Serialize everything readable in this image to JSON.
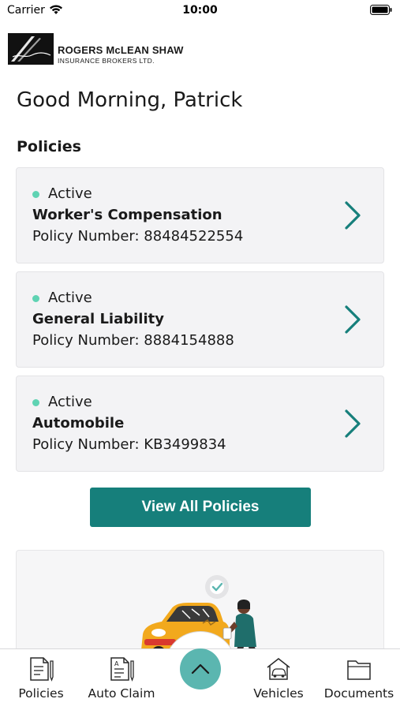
{
  "status_bar": {
    "carrier": "Carrier",
    "time": "10:00",
    "icons": [
      "wifi-icon",
      "battery-icon"
    ]
  },
  "brand": {
    "name": "ROGERS McLEAN SHAW",
    "subtitle": "INSURANCE BROKERS LTD."
  },
  "greeting": "Good Morning, Patrick",
  "policies_section": {
    "title": "Policies",
    "status_color": "#5fd3b3",
    "items": [
      {
        "status": "Active",
        "name": "Worker's Compensation",
        "number_label": "Policy Number:",
        "number": "88484522554"
      },
      {
        "status": "Active",
        "name": "General Liability",
        "number_label": "Policy Number:",
        "number": "8884154888"
      },
      {
        "status": "Active",
        "name": "Automobile",
        "number_label": "Policy Number:",
        "number": "KB3499834"
      }
    ],
    "view_all_label": "View All Policies"
  },
  "colors": {
    "accent": "#167f7b",
    "accent_light": "#5bb6b0",
    "promo_car": "#f2a91d"
  },
  "tab_bar": {
    "tabs": [
      {
        "label": "Policies",
        "icon": "policies-document-icon"
      },
      {
        "label": "Auto Claim",
        "icon": "auto-claim-document-icon"
      },
      {
        "label": "Vehicles",
        "icon": "vehicle-house-icon"
      },
      {
        "label": "Documents",
        "icon": "folder-icon"
      }
    ],
    "center_icon": "chevron-up-icon"
  }
}
